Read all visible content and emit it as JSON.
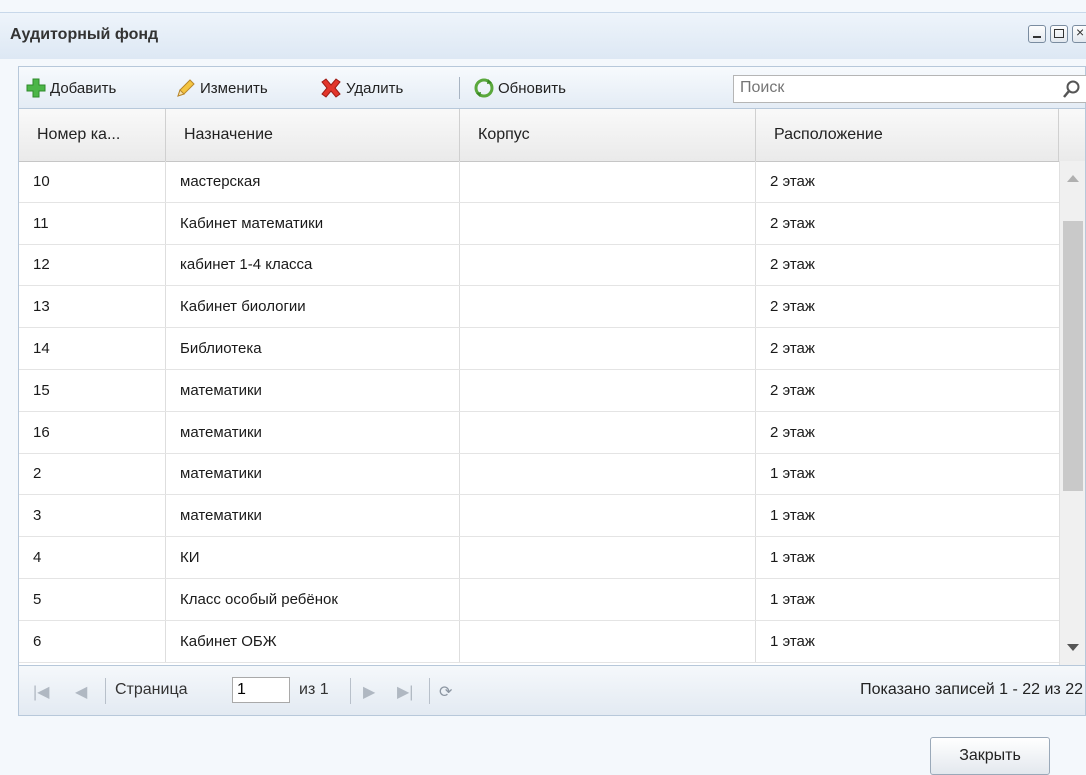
{
  "window": {
    "title": "Аудиторный фонд"
  },
  "toolbar": {
    "add_label": "Добавить",
    "edit_label": "Изменить",
    "delete_label": "Удалить",
    "refresh_label": "Обновить",
    "search_placeholder": "Поиск"
  },
  "table": {
    "columns": [
      "Номер ка...",
      "Назначение",
      "Корпус",
      "Расположение"
    ],
    "rows": [
      [
        "10",
        "мастерская",
        "",
        "2 этаж"
      ],
      [
        "11",
        "Кабинет математики",
        "",
        "2 этаж"
      ],
      [
        "12",
        "кабинет 1-4 класса",
        "",
        "2 этаж"
      ],
      [
        "13",
        "Кабинет биологии",
        "",
        "2 этаж"
      ],
      [
        "14",
        "Библиотека",
        "",
        "2 этаж"
      ],
      [
        "15",
        "математики",
        "",
        "2 этаж"
      ],
      [
        "16",
        "математики",
        "",
        "2 этаж"
      ],
      [
        "2",
        "математики",
        "",
        "1 этаж"
      ],
      [
        "3",
        "математики",
        "",
        "1 этаж"
      ],
      [
        "4",
        "КИ",
        "",
        "1 этаж"
      ],
      [
        "5",
        "Класс особый ребёнок",
        "",
        "1 этаж"
      ],
      [
        "6",
        "Кабинет ОБЖ",
        "",
        "1 этаж"
      ]
    ]
  },
  "pager": {
    "page_label": "Страница",
    "page_value": "1",
    "of_label": "из 1",
    "info": "Показано записей 1 - 22 из 22"
  },
  "footer": {
    "close_label": "Закрыть"
  },
  "colors": {
    "header_bg": "#e6eef7",
    "border": "#b7c8da"
  }
}
